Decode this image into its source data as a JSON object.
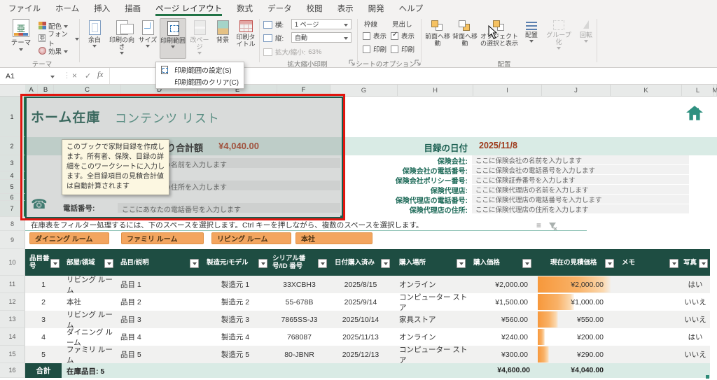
{
  "menu": {
    "items": [
      "ファイル",
      "ホーム",
      "挿入",
      "描画",
      "ページ レイアウト",
      "数式",
      "データ",
      "校閲",
      "表示",
      "開発",
      "ヘルプ"
    ],
    "active": "ページ レイアウト"
  },
  "icons": {
    "theme_glyph": "亜"
  },
  "ribbon": {
    "theme": {
      "label": "テーマ",
      "big": "テーマ",
      "items": [
        "配色",
        "フォント",
        "効果"
      ]
    },
    "page_setup": {
      "buttons": [
        "余白",
        "印刷の向き",
        "サイズ",
        "印刷範囲",
        "改ページ",
        "背景",
        "印刷タイトル"
      ]
    },
    "scale": {
      "label": "拡大縮小印刷",
      "width_label": "横:",
      "width_value": "1 ページ",
      "height_label": "縦:",
      "height_value": "自動",
      "zoom_label": "拡大/縮小:",
      "zoom_value": "63%"
    },
    "sheet_options": {
      "label": "シートのオプション",
      "gridlines": {
        "title": "枠線",
        "view": "表示",
        "print": "印刷",
        "view_checked": false,
        "print_checked": false
      },
      "headings": {
        "title": "見出し",
        "view": "表示",
        "print": "印刷",
        "view_checked": true,
        "print_checked": false
      }
    },
    "arrange": {
      "label": "配置",
      "buttons": [
        "前面へ移動",
        "背面へ移動",
        "オブジェクトの選択と表示",
        "配置",
        "グループ化",
        "回転"
      ]
    }
  },
  "print_menu": {
    "items": [
      "印刷範囲の設定(S)",
      "印刷範囲のクリア(C)"
    ]
  },
  "formula_bar": {
    "name_box": "A1",
    "fx": "fx"
  },
  "columns": [
    "A",
    "B",
    "C",
    "D",
    "E",
    "F",
    "G",
    "H",
    "I",
    "J",
    "K",
    "L",
    "M"
  ],
  "rows_gutter": [
    "1",
    "2",
    "3",
    "4",
    "5",
    "6",
    "7",
    "8",
    "9",
    "10",
    "11",
    "12",
    "13",
    "14",
    "15",
    "16"
  ],
  "sheet": {
    "title": {
      "main": "ホーム在庫",
      "sub": "コンテンツ リスト"
    },
    "estimate": {
      "label": "見積り合計額",
      "value": "¥4,040.00"
    },
    "date": {
      "label": "目録の日付",
      "value": "2025/11/8"
    },
    "owner": {
      "name_placeholder": "ここにあなたの名前を入力します",
      "address_placeholder": "ここにあなたの住所を入力します",
      "phone_label": "電話番号:",
      "phone_placeholder": "ここにあなたの電話番号を入力します"
    },
    "insurance": [
      {
        "label": "保険会社:",
        "placeholder": "ここに保険会社の名前を入力します"
      },
      {
        "label": "保険会社の電話番号:",
        "placeholder": "ここに保険会社の電話番号を入力します"
      },
      {
        "label": "保険会社ポリシー番号:",
        "placeholder": "ここに保険証券番号を入力します"
      },
      {
        "label": "保険代理店:",
        "placeholder": "ここに保険代理店の名前を入力します"
      },
      {
        "label": "保険代理店の電話番号:",
        "placeholder": "ここに保険代理店の電話番号を入力します"
      },
      {
        "label": "保険代理店の住所:",
        "placeholder": "ここに保険代理店の住所を入力します"
      }
    ],
    "tooltip": "このブックで家財目録を作成します。所有者、保険、目録の詳細をこのワークシートに入力します。全目録項目の見積合計値は自動計算されます",
    "filter_note": "在庫表をフィルター処理するには、下のスペースを選択します。Ctrl キーを押しながら、複数のスペースを選択します。",
    "slicers": [
      "ダイニング ルーム",
      "ファミリ ルーム",
      "リビング ルーム",
      "本社"
    ]
  },
  "table": {
    "headers": [
      "品目番号",
      "部屋/領域",
      "品目/説明",
      "製造元/モデル",
      "シリアル番号/ID 番号",
      "日付購入済み",
      "購入場所",
      "購入価格",
      "現在の見積価格",
      "メモ",
      "写真"
    ],
    "rows": [
      {
        "cells": [
          "1",
          "リビング ルーム",
          "品目 1",
          "製造元 1",
          "33XCBH3",
          "2025/8/15",
          "オンライン",
          "¥2,000.00",
          "¥2,000.00",
          "",
          "はい"
        ],
        "bar": 100
      },
      {
        "cells": [
          "2",
          "本社",
          "品目 2",
          "製造元 2",
          "55-678B",
          "2025/9/14",
          "コンピューター ストア",
          "¥1,500.00",
          "¥1,000.00",
          "",
          "いいえ"
        ],
        "bar": 50
      },
      {
        "cells": [
          "3",
          "リビング ルーム",
          "品目 3",
          "製造元 3",
          "7865SS-J3",
          "2025/10/14",
          "家具ストア",
          "¥560.00",
          "¥550.00",
          "",
          "いいえ"
        ],
        "bar": 28
      },
      {
        "cells": [
          "4",
          "ダイニング ルーム",
          "品目 4",
          "製造元 4",
          "768087",
          "2025/11/13",
          "オンライン",
          "¥240.00",
          "¥200.00",
          "",
          "はい"
        ],
        "bar": 10
      },
      {
        "cells": [
          "5",
          "ファミリ ルーム",
          "品目 5",
          "製造元 5",
          "80-JBNR",
          "2025/12/13",
          "コンピューター ストア",
          "¥300.00",
          "¥290.00",
          "",
          "いいえ"
        ],
        "bar": 15
      }
    ],
    "total": {
      "label": "合計",
      "items": "在庫品目: 5",
      "purchase": "¥4,600.00",
      "estimate": "¥4,040.00"
    }
  },
  "colors": {
    "accent_green": "#217346",
    "header_green": "#1e4d42",
    "teal_band": "#d9ebe5",
    "slicer_orange": "#f3a55f",
    "bar_orange": "#f7983b",
    "value_red": "#9e3a1b",
    "annotation_red": "#e0160f"
  }
}
